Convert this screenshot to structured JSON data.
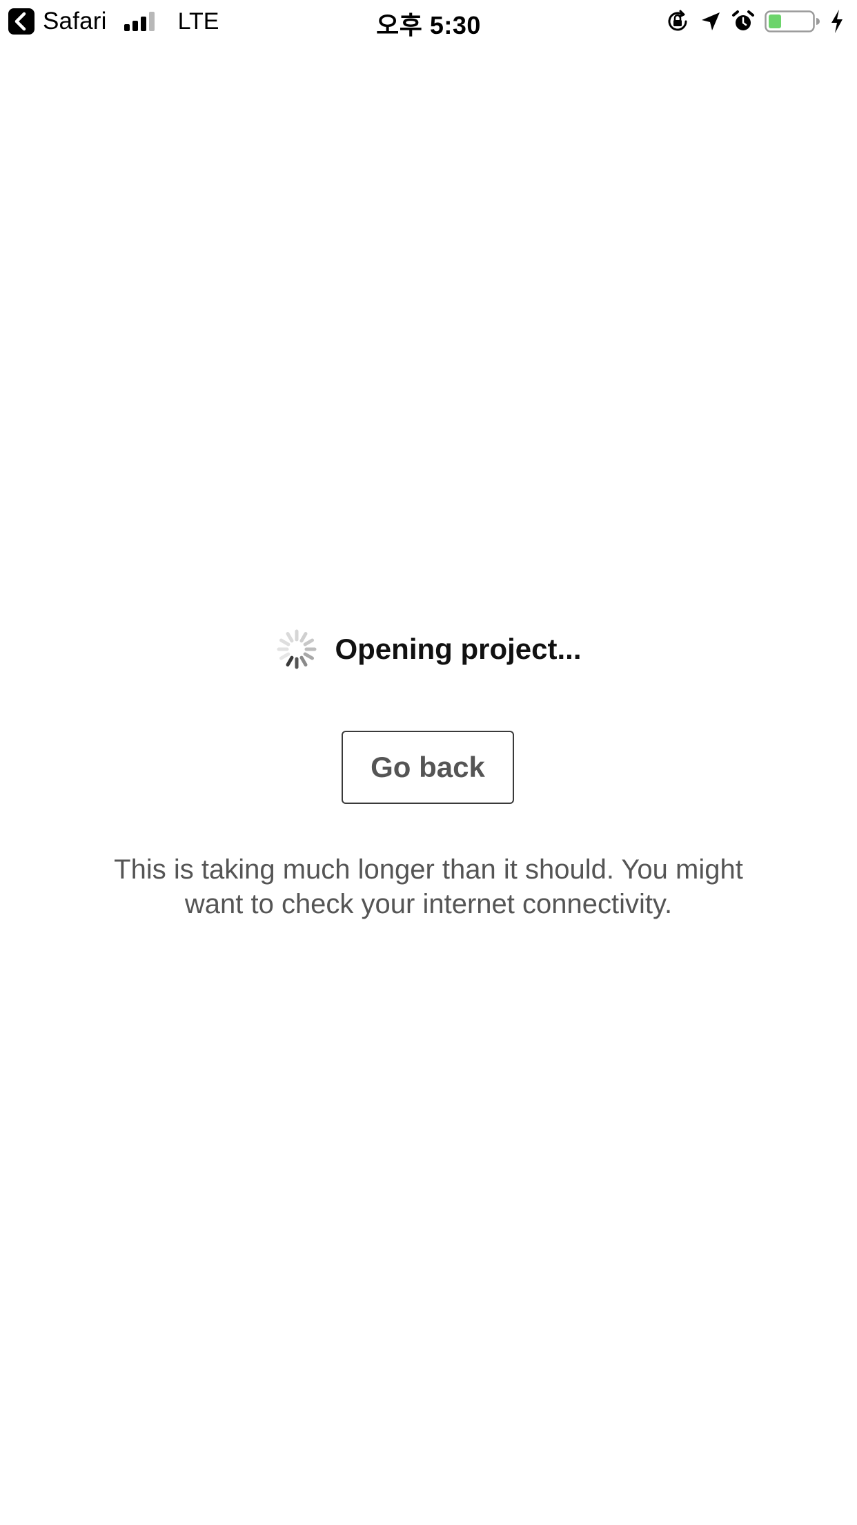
{
  "status_bar": {
    "back_app_label": "Safari",
    "network": "LTE",
    "time": "오후 5:30",
    "battery_color": "#6cd46b",
    "icons": [
      "back-arrow-icon",
      "cellular-signal-icon",
      "rotation-lock-icon",
      "location-arrow-icon",
      "alarm-clock-icon",
      "battery-icon",
      "charging-bolt-icon"
    ]
  },
  "main": {
    "loading_text": "Opening project...",
    "go_back_label": "Go back",
    "notice": "This is taking much longer than it should. You might want to check your internet connectivity."
  }
}
